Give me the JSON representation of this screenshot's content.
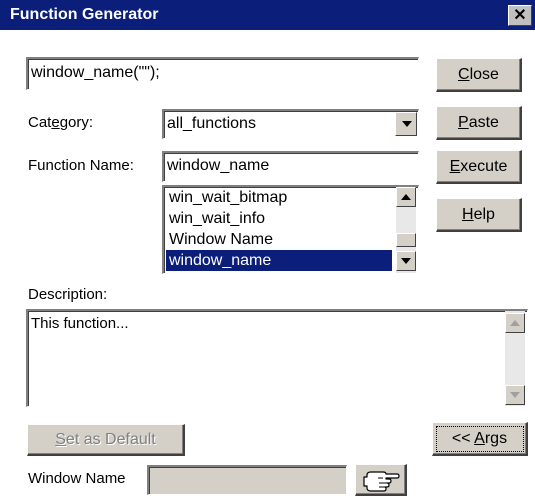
{
  "window": {
    "title": "Function Generator",
    "close_glyph": "✕"
  },
  "expression": {
    "value": "window_name(\"\");"
  },
  "buttons": {
    "close": {
      "u": "C",
      "rest": "lose"
    },
    "paste": {
      "u": "P",
      "rest": "aste"
    },
    "execute": {
      "u": "E",
      "rest": "xecute"
    },
    "help": {
      "u": "H",
      "rest": "elp"
    },
    "set_default": {
      "u": "S",
      "rest": "et as Default"
    },
    "args": {
      "pre": "<< ",
      "u": "A",
      "rest": "rgs"
    }
  },
  "category": {
    "label_pre": "Cat",
    "label_u": "e",
    "label_post": "gory:",
    "selected": "all_functions"
  },
  "function_name": {
    "label": "Function Name:",
    "value": "window_name",
    "list": [
      {
        "text": "win_wait_bitmap",
        "selected": false
      },
      {
        "text": "win_wait_info",
        "selected": false
      },
      {
        "text": "Window Name",
        "selected": false
      },
      {
        "text": "window_name",
        "selected": true
      }
    ]
  },
  "description": {
    "label": "Description:",
    "text": "This function..."
  },
  "window_name_field": {
    "label": "Window Name",
    "value": ""
  },
  "icons": {
    "pointer": "pointing-hand-icon"
  }
}
